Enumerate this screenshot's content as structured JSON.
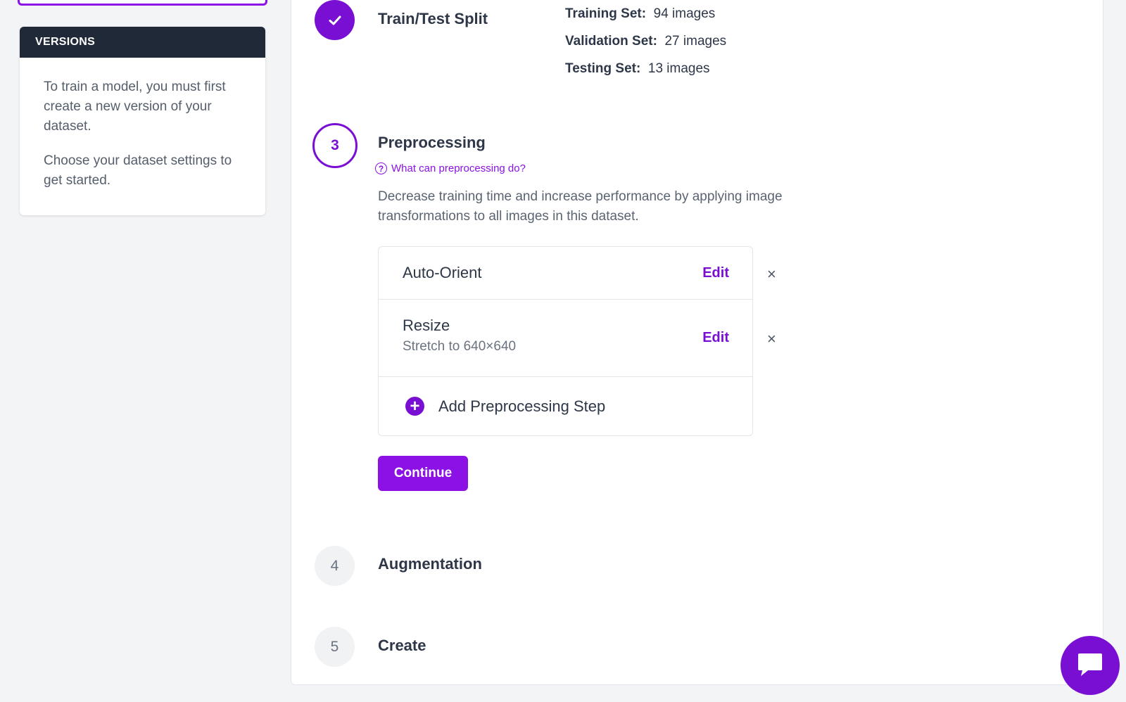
{
  "sidebar": {
    "versions_title": "VERSIONS",
    "intro_text": "To train a model, you must first create a new version of your dataset.",
    "hint_text": "Choose your dataset settings to get started."
  },
  "steps": {
    "train_test_split": {
      "title": "Train/Test Split",
      "training_label": "Training Set:",
      "training_value": "94 images",
      "validation_label": "Validation Set:",
      "validation_value": "27 images",
      "testing_label": "Testing Set:",
      "testing_value": "13 images"
    },
    "preprocessing": {
      "number": "3",
      "title": "Preprocessing",
      "help_link": "What can preprocessing do?",
      "description": "Decrease training time and increase performance by applying image transformations to all images in this dataset.",
      "items": [
        {
          "name": "Auto-Orient",
          "detail": "",
          "edit_label": "Edit",
          "remove_label": "×"
        },
        {
          "name": "Resize",
          "detail": "Stretch to 640×640",
          "edit_label": "Edit",
          "remove_label": "×"
        }
      ],
      "add_label": "Add Preprocessing Step",
      "continue_label": "Continue"
    },
    "augmentation": {
      "number": "4",
      "title": "Augmentation"
    },
    "create": {
      "number": "5",
      "title": "Create"
    }
  },
  "colors": {
    "accent": "#8b11e5",
    "accent_dark": "#7a0fd4",
    "header_dark": "#1f2937"
  }
}
